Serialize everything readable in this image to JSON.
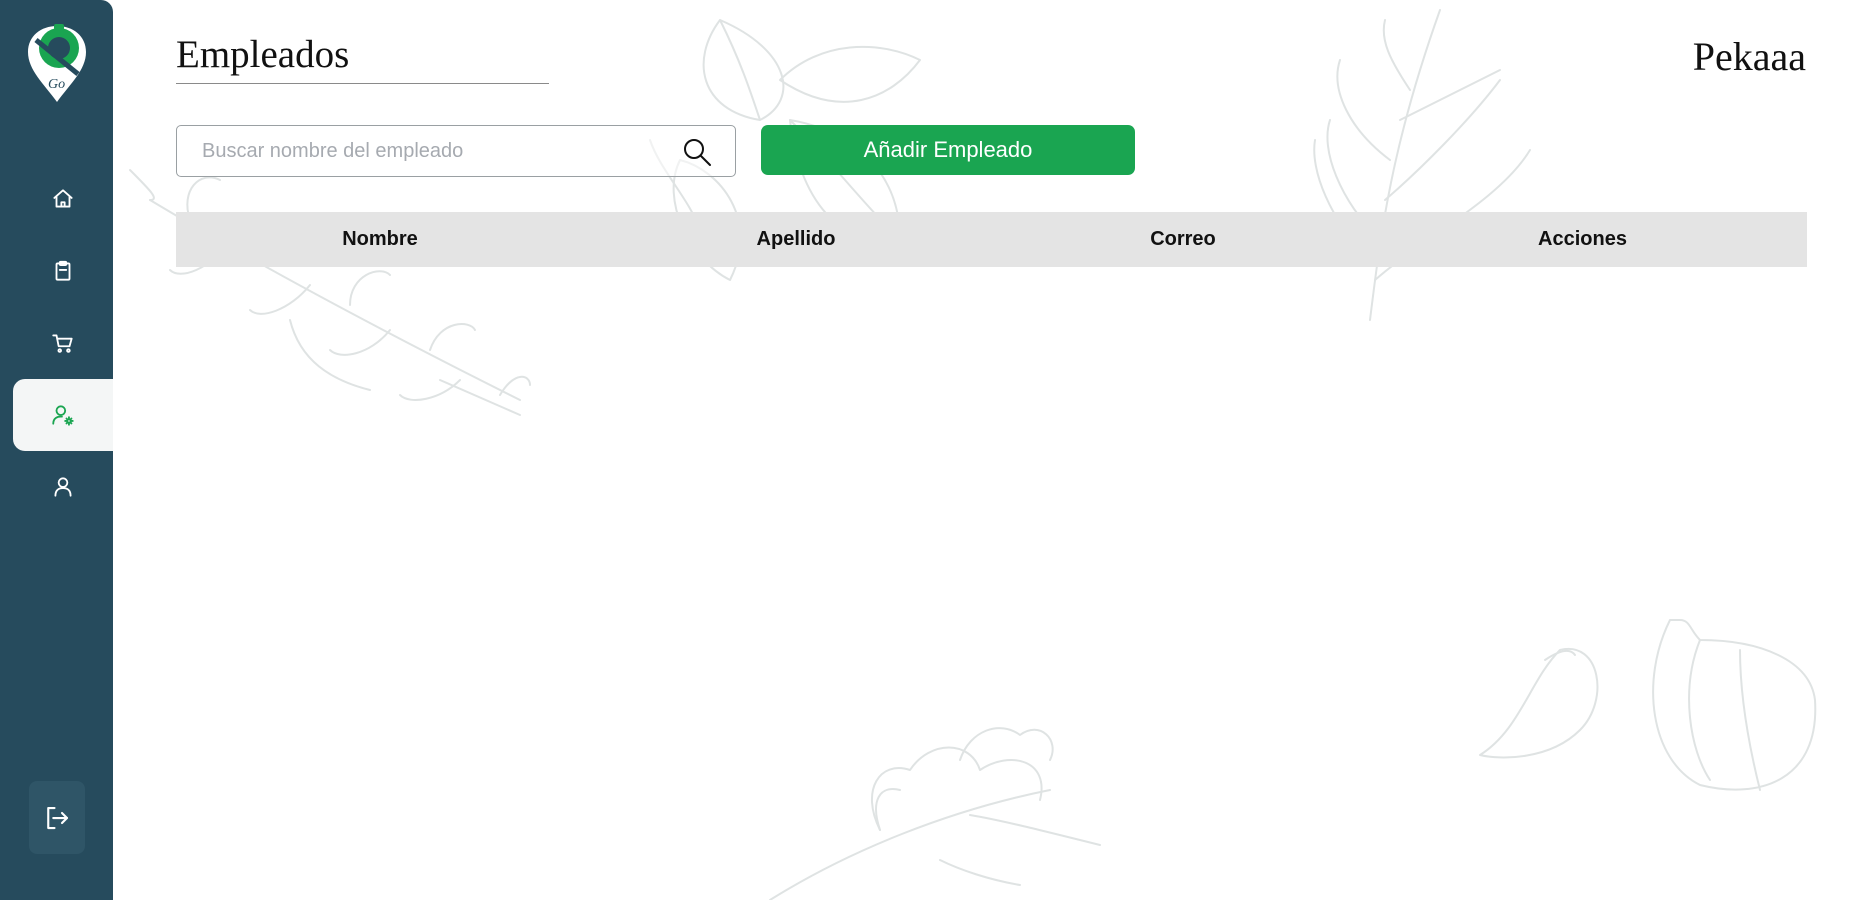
{
  "app": {
    "logo_text": "Go"
  },
  "sidebar": {
    "items": [
      {
        "icon": "home-icon",
        "active": false
      },
      {
        "icon": "clipboard-icon",
        "active": false
      },
      {
        "icon": "cart-icon",
        "active": false
      },
      {
        "icon": "user-gear-icon",
        "active": true
      },
      {
        "icon": "user-icon",
        "active": false
      }
    ],
    "logout_icon": "logout-icon"
  },
  "header": {
    "title": "Empleados",
    "user_name": "Pekaaa"
  },
  "toolbar": {
    "search_placeholder": "Buscar nombre del empleado",
    "search_value": "",
    "add_label": "Añadir Empleado"
  },
  "table": {
    "columns": [
      "Nombre",
      "Apellido",
      "Correo",
      "Acciones"
    ],
    "rows": []
  },
  "colors": {
    "sidebar": "#264b5d",
    "accent": "#1aa551",
    "table_header": "#e4e4e4"
  }
}
